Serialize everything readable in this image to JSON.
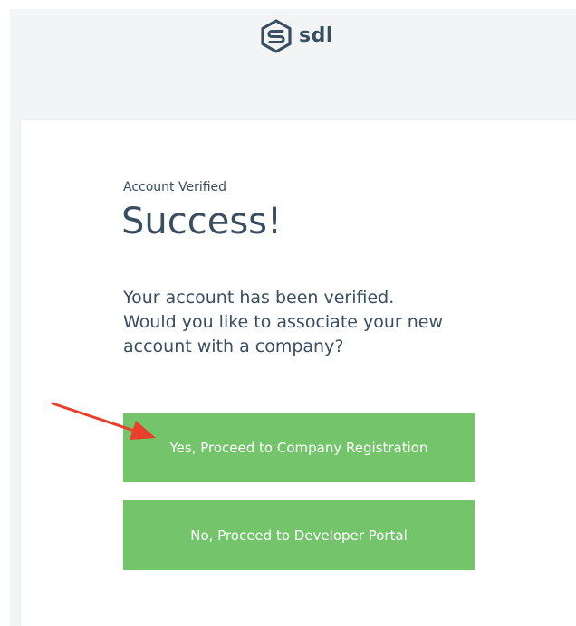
{
  "brand": {
    "logo_icon": "sdl-hexagon-logo-icon",
    "name": "sdl",
    "color": "#394e60"
  },
  "content": {
    "eyebrow": "Account Verified",
    "title": "Success!",
    "message_lines": [
      "Your account has been verified.",
      "Would you like to associate your new",
      "account with a company?"
    ]
  },
  "actions": {
    "yes_label": "Yes, Proceed to Company Registration",
    "no_label": "No, Proceed to Developer Portal",
    "button_color": "#73c46b"
  },
  "annotation": {
    "icon": "red-arrow-icon",
    "color": "#e8402b"
  }
}
